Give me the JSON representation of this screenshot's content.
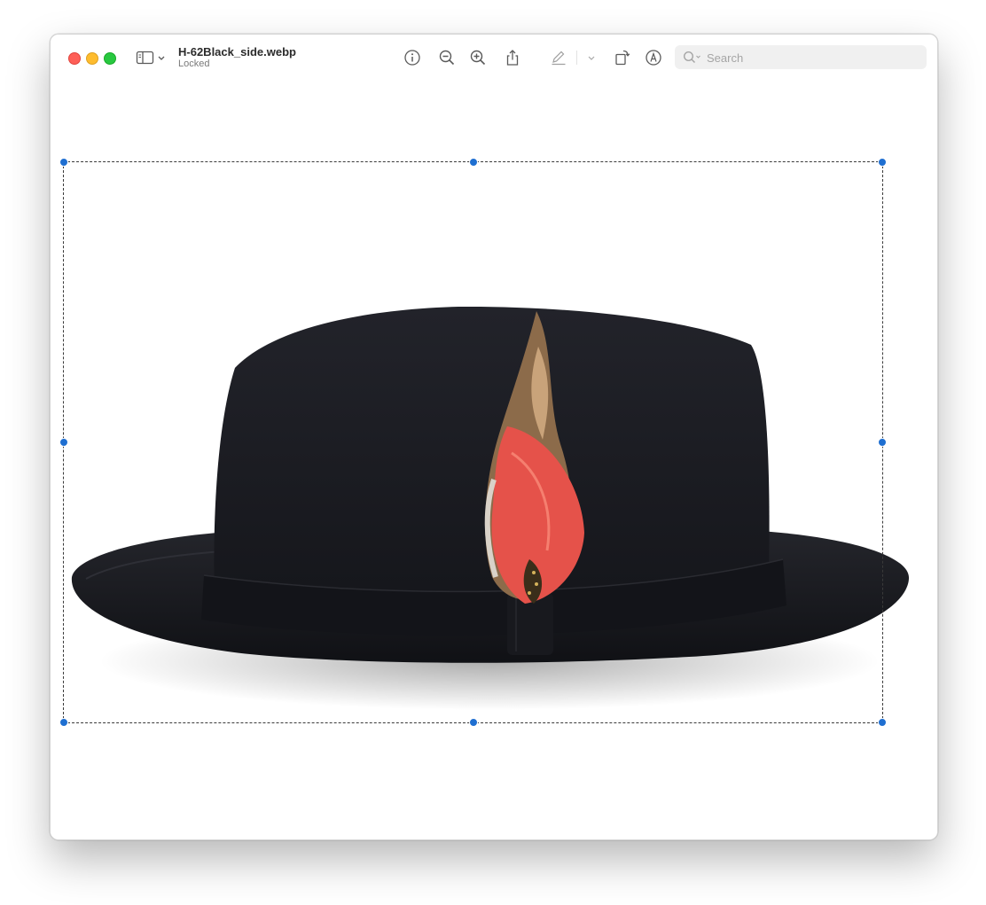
{
  "window": {
    "title": "H-62Black_side.webp",
    "subtitle": "Locked"
  },
  "toolbar": {
    "icons": [
      "sidebar-icon",
      "chevron-down-icon",
      "info-icon",
      "zoom-out-icon",
      "zoom-in-icon",
      "share-icon",
      "markup-pen-icon",
      "chevron-down-icon",
      "rotate-icon",
      "annotate-icon"
    ]
  },
  "search": {
    "placeholder": "Search",
    "value": ""
  },
  "image": {
    "description_icon": "hat-image",
    "selection": "active"
  },
  "colors": {
    "close": "#fe5f57",
    "minimize": "#febc2e",
    "maximize": "#28c840",
    "selection_handle": "#1f6fd1",
    "feather_red": "#e5524a"
  }
}
